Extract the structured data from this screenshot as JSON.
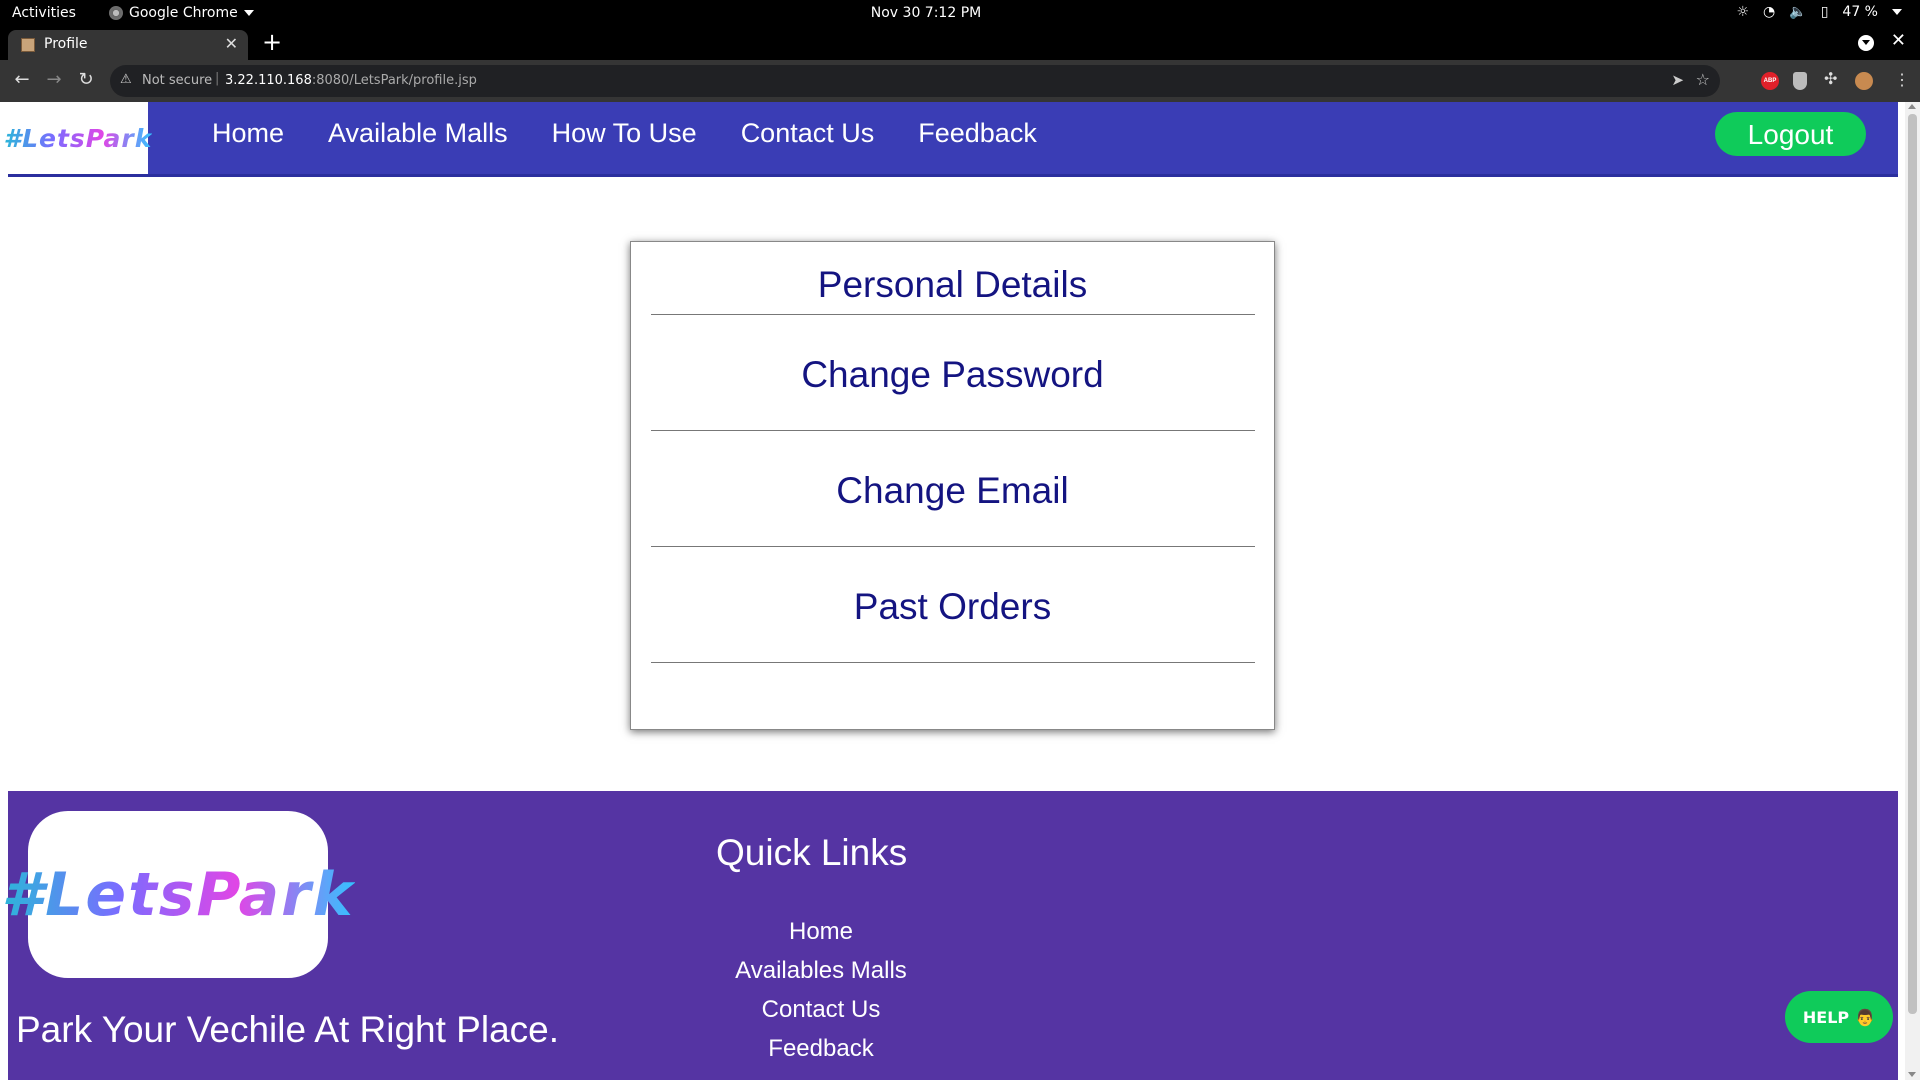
{
  "os_bar": {
    "activities": "Activities",
    "app_name": "Google Chrome",
    "clock": "Nov 30  7:12 PM",
    "battery": "47 %"
  },
  "browser": {
    "tab_title": "Profile",
    "security_label": "Not secure",
    "url_host": "3.22.110.168",
    "url_rest": ":8080/LetsPark/profile.jsp",
    "abp_label": "ABP"
  },
  "header": {
    "logo": "#LetsPark",
    "nav": [
      "Home",
      "Available Malls",
      "How To Use",
      "Contact Us",
      "Feedback"
    ],
    "logout": "Logout"
  },
  "profile_card": {
    "title": "Personal Details",
    "items": [
      "Change Password",
      "Change Email",
      "Past Orders"
    ]
  },
  "footer": {
    "logo": "#LetsPark",
    "tagline": "Park Your Vechile At Right Place.",
    "quick_links_title": "Quick Links",
    "quick_links": [
      "Home",
      "Availables Malls",
      "Contact Us",
      "Feedback"
    ],
    "help_label": "HELP",
    "help_emoji": "👨"
  },
  "colors": {
    "nav_bg": "#3a3db5",
    "footer_bg": "#5534a3",
    "accent_green": "#0fcb5a",
    "card_text": "#141481"
  }
}
